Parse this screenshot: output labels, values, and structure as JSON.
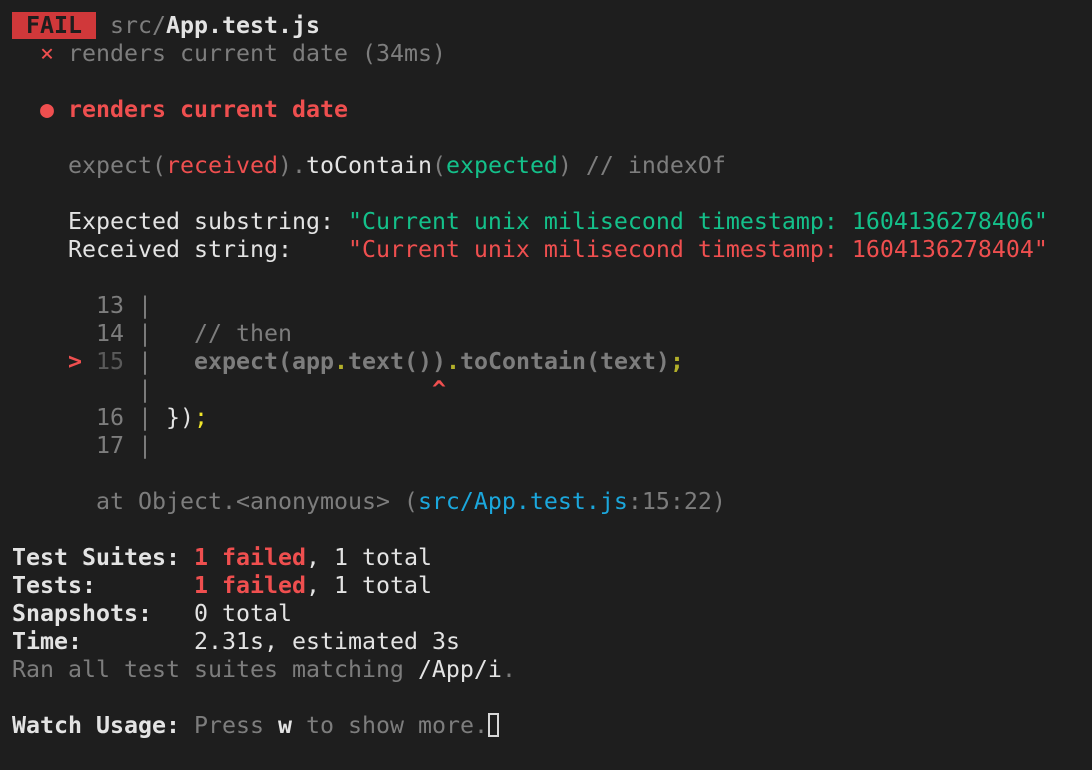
{
  "header": {
    "badge": " FAIL ",
    "path_dir": " src/",
    "path_file": "App.test.js"
  },
  "test_result": {
    "indent": "  ",
    "fail_icon": "×",
    "label": " renders current date (34ms)"
  },
  "failure": {
    "bullet": "  ● ",
    "title": "renders current date"
  },
  "matcher": {
    "indent": "    ",
    "p1": "expect(",
    "received": "received",
    "p2": ").",
    "method": "toContain",
    "p3": "(",
    "expected": "expected",
    "p4": ") // indexOf"
  },
  "diff": {
    "expected_label": "    Expected substring: ",
    "expected_value": "\"Current unix milisecond timestamp: 1604136278406\"",
    "received_label": "    Received string:    ",
    "received_value": "\"Current unix milisecond timestamp: 1604136278404\""
  },
  "code_frame": {
    "l13": "      13 |",
    "l14_num": "      14 |",
    "l14_code": "   // then",
    "l15_marker": "    > ",
    "l15_num": "15",
    "l15_bar": " |   ",
    "l15_a": "expect(app",
    "l15_dot1": ".",
    "l15_b": "text())",
    "l15_dot2": ".",
    "l15_c": "toContain(text)",
    "l15_semi": ";",
    "caret_bar": "         |                    ",
    "caret": "^",
    "l16_num": "      16 |",
    "l16_code": " })",
    "l16_semi": ";",
    "l17": "      17 |"
  },
  "stack": {
    "p1": "      at Object.<anonymous> (",
    "file": "src/App.test.js",
    "p2": ":15:22)"
  },
  "summary": {
    "suites_label": "Test Suites: ",
    "suites_failed": "1 failed",
    "suites_total": ", 1 total",
    "tests_label": "Tests:       ",
    "tests_failed": "1 failed",
    "tests_total": ", 1 total",
    "snapshots_label": "Snapshots:   ",
    "snapshots_value": "0 total",
    "time_label": "Time:        ",
    "time_value": "2.31s, estimated 3s",
    "ran_text": "Ran all test suites matching ",
    "ran_pattern": "/App/i",
    "ran_end": "."
  },
  "watch": {
    "label": "Watch Usage: ",
    "press": "Press ",
    "key": "w",
    "rest": " to show more."
  }
}
